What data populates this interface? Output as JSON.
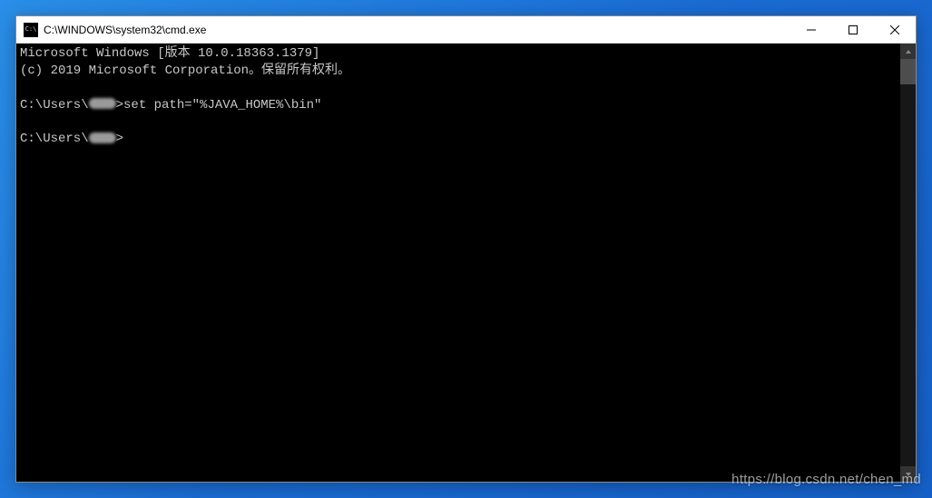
{
  "titlebar": {
    "title": "C:\\WINDOWS\\system32\\cmd.exe"
  },
  "terminal": {
    "line1": "Microsoft Windows [版本 10.0.18363.1379]",
    "line2": "(c) 2019 Microsoft Corporation。保留所有权利。",
    "prompt1_pre": "C:\\Users\\",
    "cmd1": ">set path=\"%JAVA_HOME%\\bin\"",
    "prompt2_pre": "C:\\Users\\",
    "prompt2_post": ">"
  },
  "watermark": "https://blog.csdn.net/chen_md"
}
